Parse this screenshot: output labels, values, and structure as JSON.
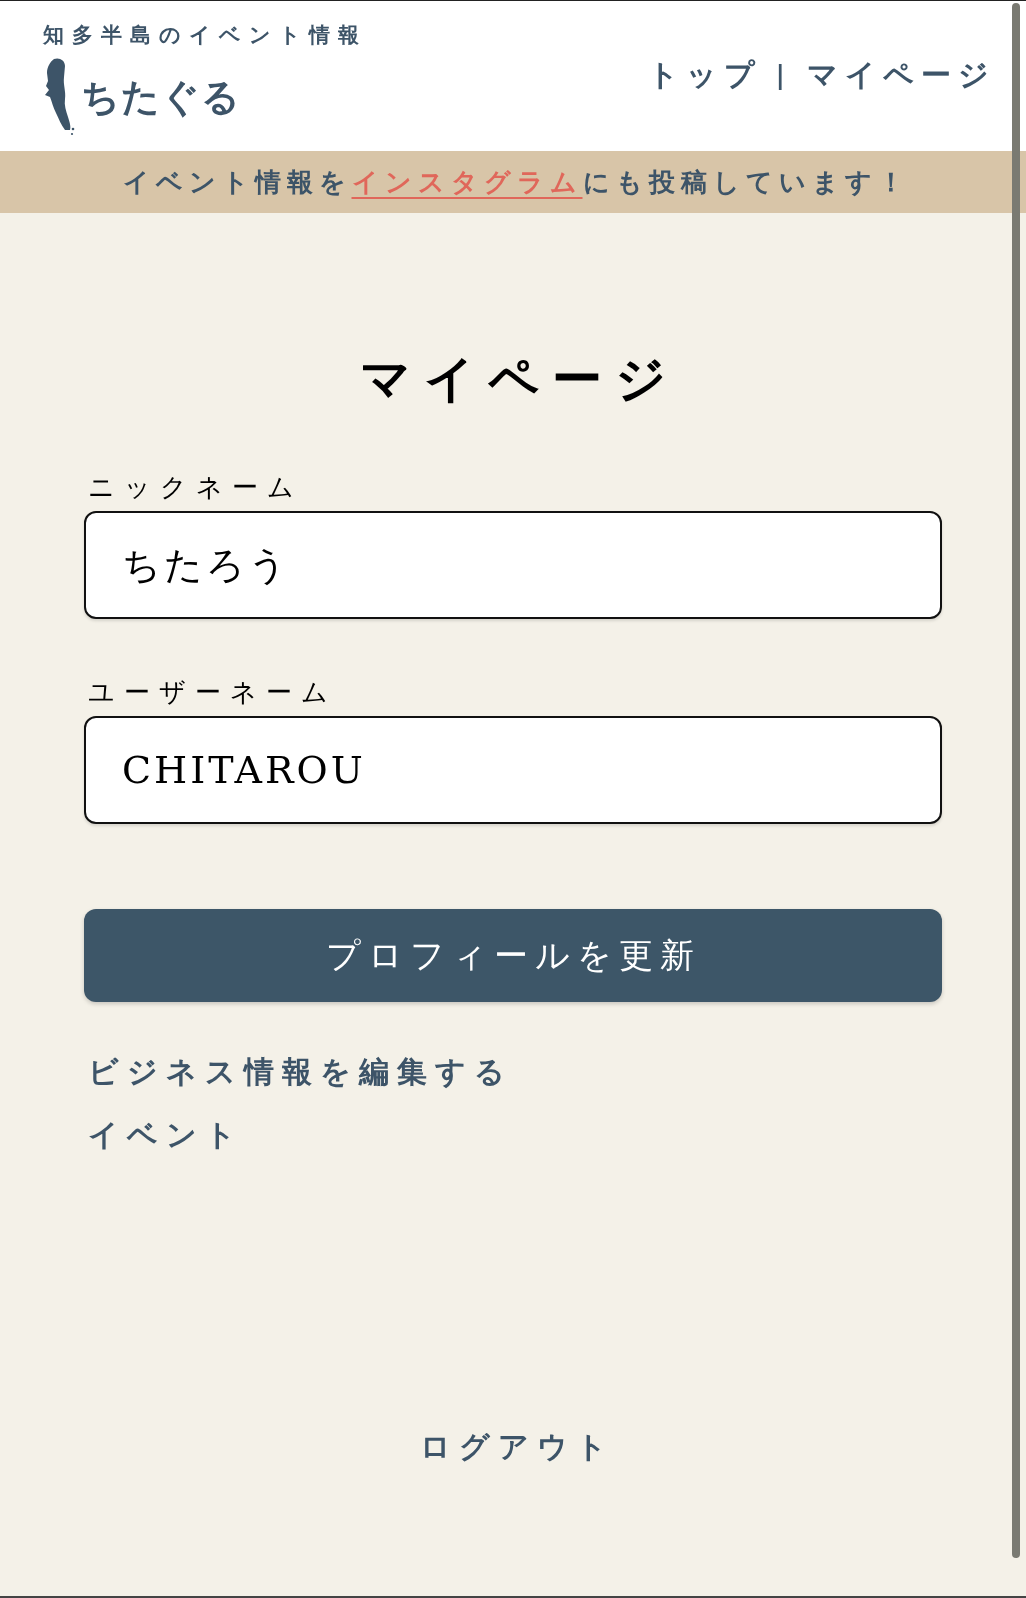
{
  "header": {
    "tagline": "知多半島のイベント情報",
    "logo_text": "ちたぐる",
    "nav": [
      {
        "label": "トップ"
      },
      {
        "label": "マイページ"
      }
    ],
    "separator": "|"
  },
  "banner": {
    "text_before": "イベント情報を",
    "link": "インスタグラム",
    "text_after": "にも投稿しています！"
  },
  "page": {
    "title": "マイページ",
    "fields": [
      {
        "label": "ニックネーム",
        "value": "ちたろう"
      },
      {
        "label": "ユーザーネーム",
        "value": "CHITAROU"
      }
    ],
    "submit_button": "プロフィールを更新",
    "links": [
      "ビジネス情報を編集する",
      "イベント"
    ],
    "logout": "ログアウト"
  }
}
